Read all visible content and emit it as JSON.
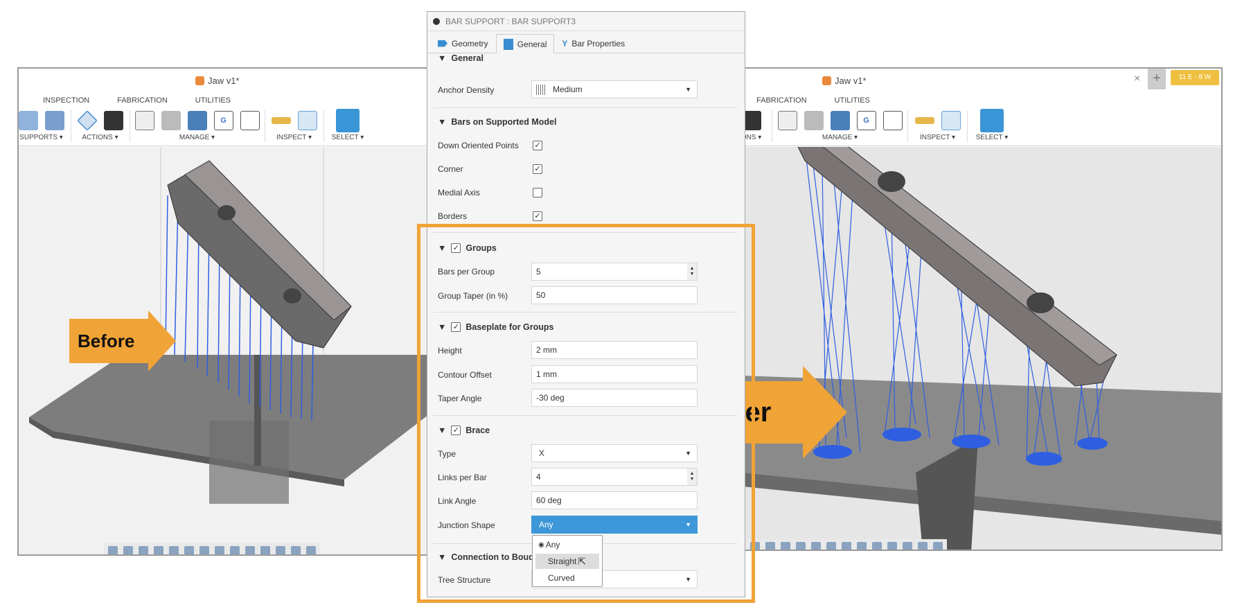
{
  "left_window": {
    "doc_title": "Jaw v1*",
    "menu_tabs": [
      "INSPECTION",
      "FABRICATION",
      "UTILITIES"
    ],
    "groups": [
      "SUPPORTS ▾",
      "ACTIONS ▾",
      "MANAGE ▾",
      "INSPECT ▾",
      "SELECT ▾"
    ]
  },
  "right_window": {
    "doc_title": "Jaw v1*",
    "menu_tabs": [
      "FABRICATION",
      "UTILITIES"
    ],
    "groups": [
      "ONS ▾",
      "MANAGE ▾",
      "INSPECT ▾",
      "SELECT ▾"
    ],
    "close": "×",
    "new_tab": "+",
    "badge": "11 E - 8 W"
  },
  "annotations": {
    "before": "Before",
    "after": "After"
  },
  "panel": {
    "title": "BAR SUPPORT : BAR SUPPORT3",
    "tabs": [
      "Geometry",
      "General",
      "Bar Properties"
    ],
    "general": {
      "header": "General",
      "anchor_density_label": "Anchor Density",
      "anchor_density": "Medium"
    },
    "bars": {
      "header": "Bars on Supported Model",
      "items": [
        {
          "label": "Down Oriented Points",
          "checked": true
        },
        {
          "label": "Corner",
          "checked": true
        },
        {
          "label": "Medial Axis",
          "checked": false
        },
        {
          "label": "Borders",
          "checked": true
        }
      ]
    },
    "groups": {
      "header": "Groups",
      "bars_per_group_label": "Bars per Group",
      "bars_per_group": "5",
      "taper_label": "Group Taper (in %)",
      "taper": "50"
    },
    "baseplate": {
      "header": "Baseplate for Groups",
      "height_label": "Height",
      "height": "2 mm",
      "contour_label": "Contour Offset",
      "contour": "1 mm",
      "taper_label": "Taper Angle",
      "taper": "-30 deg"
    },
    "brace": {
      "header": "Brace",
      "type_label": "Type",
      "type": "X",
      "links_label": "Links per Bar",
      "links": "4",
      "angle_label": "Link Angle",
      "angle": "60 deg",
      "junction_label": "Junction Shape",
      "junction": "Any"
    },
    "connection": {
      "header": "Connection to Bouq",
      "tree_label": "Tree Structure"
    },
    "junction_options": [
      "Any",
      "Straight",
      "Curved"
    ]
  },
  "colors": {
    "accent": "#3d97d8",
    "highlight": "#f0a336",
    "support": "#2f5fe0"
  }
}
